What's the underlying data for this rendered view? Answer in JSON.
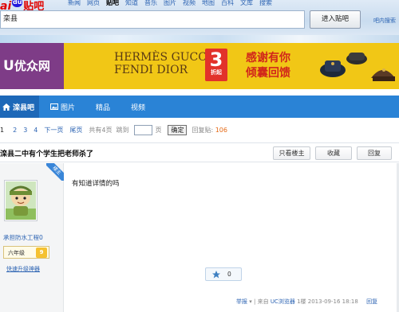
{
  "topbar": {
    "logo_text_left": "ai",
    "logo_paw": "du",
    "logo_text_right": "贴吧",
    "nav": [
      "新闻",
      "网页",
      "贴吧",
      "知道",
      "音乐",
      "图片",
      "视频",
      "地图",
      "百科",
      "文库",
      "搜索"
    ],
    "active_nav_index": 2,
    "search_value": "栾县",
    "enter_button": "进入贴吧",
    "help_link": "吧内搜索"
  },
  "banner": {
    "site_prefix": "U",
    "site_name": "优众网",
    "brands_line1": "HERMÈS GUCCI",
    "brands_line2": "FENDI DIOR",
    "discount_number": "3",
    "discount_unit": "折起",
    "thanks_line1": "感谢有你",
    "thanks_line2": "倾囊回馈",
    "accent_purple": "#7e3c87",
    "accent_yellow": "#f1c716"
  },
  "bluenav": {
    "home_label": "滦县吧",
    "pics_label": "图片",
    "jingpin_label": "精品",
    "video_label": "视频",
    "color": "#2a83d6"
  },
  "pager": {
    "pages": [
      "1",
      "2",
      "3",
      "4"
    ],
    "next": "下一页",
    "last": "尾页",
    "total": "共有4页",
    "jump": "跳到",
    "page_unit": "页",
    "confirm": "确定",
    "reply_label": "回复贴:",
    "reply_count": "106"
  },
  "thread": {
    "title": "滦县二中有个学生把老师杀了",
    "only_op_button": "只看楼主",
    "favorite_button": "收藏",
    "reply_button": "回复"
  },
  "post": {
    "op_ribbon": "楼主",
    "username": "承担防水工程0",
    "level_name": "六年级",
    "level_number": "9",
    "upgrade_link": "快速升级神器",
    "content": "有知道详情的吗",
    "vote_count": "0",
    "report": "举报",
    "source_prefix": "来自",
    "source_link": "UC浏览器",
    "floor": "1楼",
    "datetime": "2013-09-16 18:18",
    "reply_link": "回复"
  }
}
